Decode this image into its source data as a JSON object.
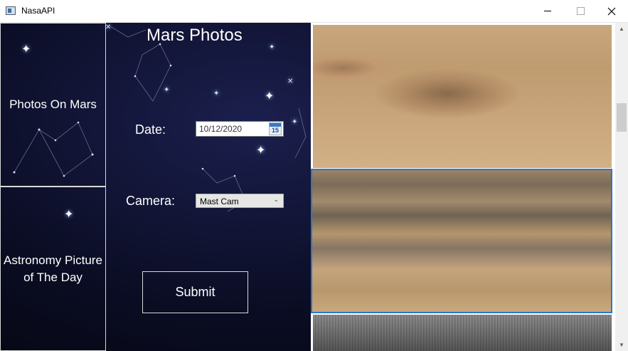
{
  "window": {
    "title": "NasaAPI"
  },
  "nav": {
    "photos_on_mars": "Photos On Mars",
    "apod": "Astronomy Picture\nof The Day"
  },
  "form": {
    "title": "Mars Photos",
    "date_label": "Date:",
    "date_value": "10/12/2020",
    "calendar_day": "15",
    "camera_label": "Camera:",
    "camera_value": "Mast Cam",
    "submit_label": "Submit"
  },
  "photos": {
    "count_visible": 3,
    "selected_index": 1
  },
  "colors": {
    "selection_border": "#2a78c8",
    "panel_border": "#d8d8d8"
  }
}
